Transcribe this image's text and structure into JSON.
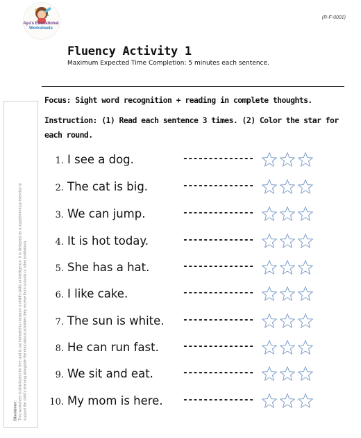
{
  "logo": {
    "line1": "Aya's Educational",
    "line2": "Worksheets"
  },
  "code": "(R-F-0001)",
  "title": "Fluency Activity 1",
  "subtitle": "Maximum Expected Time Completion: 5 minutes each sentence.",
  "focus": "Focus: Sight word recognition + reading in complete thoughts.",
  "instruction": "Instruction: (1) Read each sentence 3 times. (2) Color the star for each round.",
  "disclaimer": {
    "label": "Disclaimer:",
    "line1": "This worksheet is distributed for free and is not intended to measure a child's skills or intelligence. It is designed as a supplementary exercise to",
    "line2": "support the child's learning alongside the educational activities they receive from schools or other institutions."
  },
  "dash_text": "--------------",
  "star_color": "#7f9fc9",
  "stars_per_row": 3,
  "sentences": [
    {
      "number": "1.",
      "text": "I see a dog."
    },
    {
      "number": "2.",
      "text": "The cat is big."
    },
    {
      "number": "3.",
      "text": "We can jump."
    },
    {
      "number": "4.",
      "text": "It is hot today."
    },
    {
      "number": "5.",
      "text": "She has a hat."
    },
    {
      "number": "6.",
      "text": "I like cake."
    },
    {
      "number": "7.",
      "text": "The sun is white."
    },
    {
      "number": "8.",
      "text": "He can run fast."
    },
    {
      "number": "9.",
      "text": "We sit and eat."
    },
    {
      "number": "10.",
      "text": "My mom is here."
    }
  ]
}
